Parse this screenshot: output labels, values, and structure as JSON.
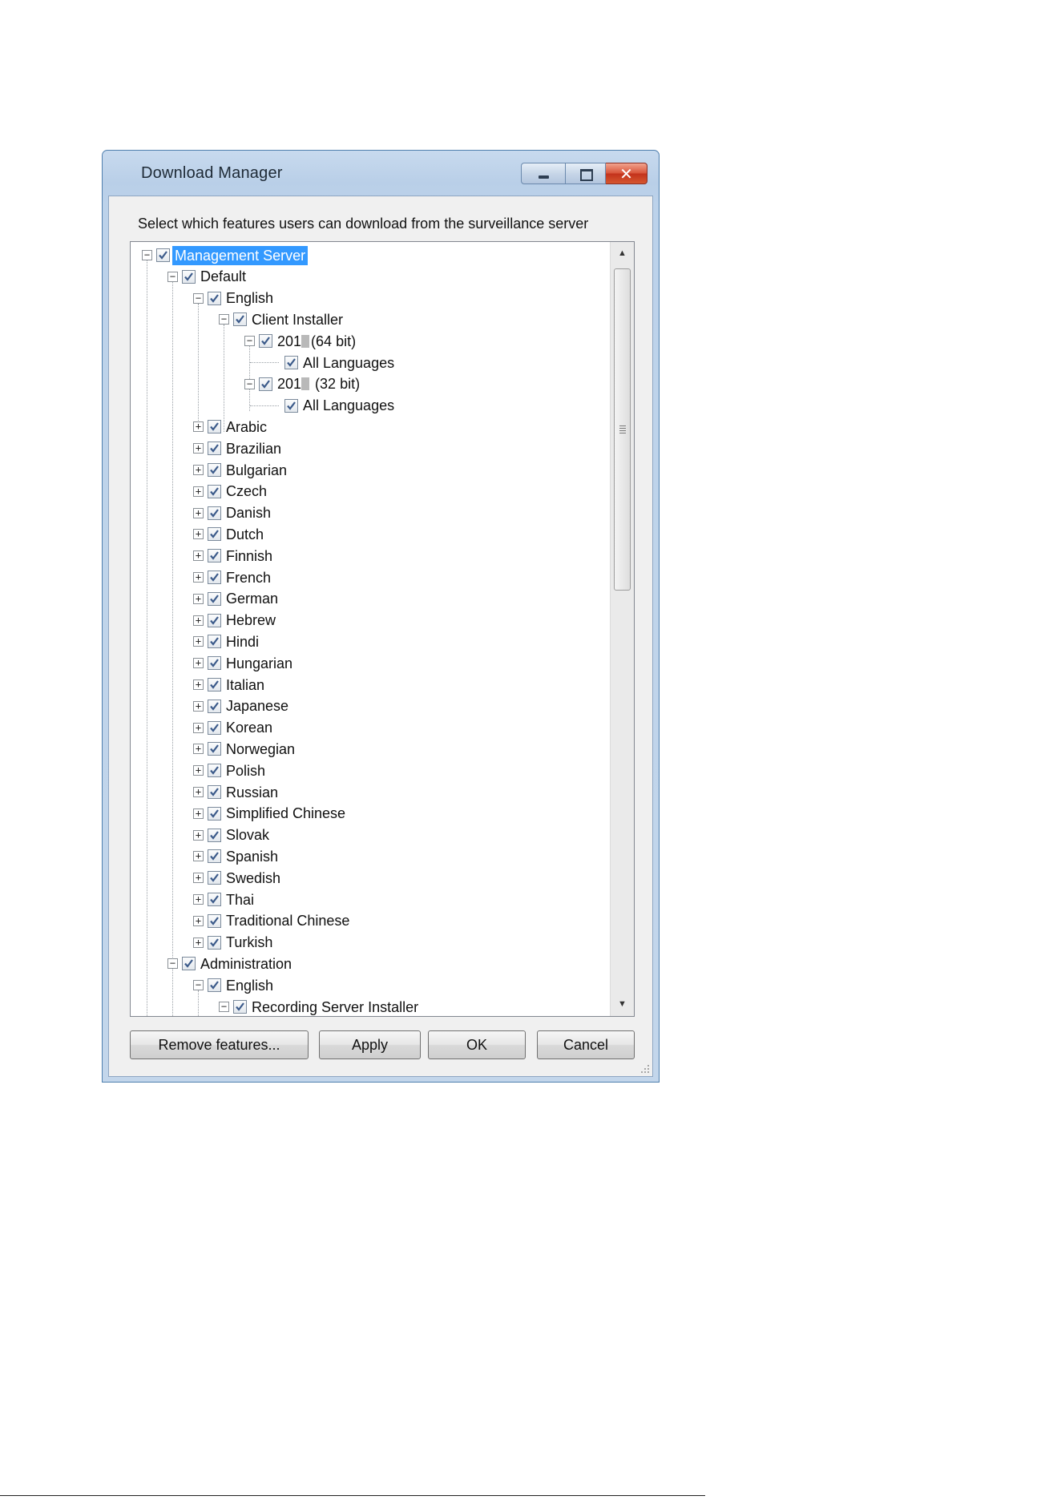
{
  "window": {
    "title": "Download Manager",
    "instruction": "Select which features users can download from the surveillance server"
  },
  "tree": {
    "nodes": [
      {
        "label": "Management Server",
        "level": 0,
        "expander": "minus",
        "checked": true,
        "selected": true
      },
      {
        "label": "Default",
        "level": 1,
        "expander": "minus",
        "checked": true
      },
      {
        "label": "English",
        "level": 2,
        "expander": "minus",
        "checked": true
      },
      {
        "label": "Client Installer",
        "level": 3,
        "expander": "minus",
        "checked": true
      },
      {
        "label": "201",
        "suffix": "(64 bit)",
        "redacted": true,
        "level": 4,
        "expander": "minus",
        "checked": true
      },
      {
        "label": "All Languages",
        "level": 5,
        "expander": "none",
        "checked": true
      },
      {
        "label": "201",
        "suffix": " (32 bit)",
        "redacted": true,
        "level": 4,
        "expander": "minus",
        "checked": true
      },
      {
        "label": "All Languages",
        "level": 5,
        "expander": "none",
        "checked": true
      },
      {
        "label": "Arabic",
        "level": 2,
        "expander": "plus",
        "checked": true
      },
      {
        "label": "Brazilian",
        "level": 2,
        "expander": "plus",
        "checked": true
      },
      {
        "label": "Bulgarian",
        "level": 2,
        "expander": "plus",
        "checked": true
      },
      {
        "label": "Czech",
        "level": 2,
        "expander": "plus",
        "checked": true
      },
      {
        "label": "Danish",
        "level": 2,
        "expander": "plus",
        "checked": true
      },
      {
        "label": "Dutch",
        "level": 2,
        "expander": "plus",
        "checked": true
      },
      {
        "label": "Finnish",
        "level": 2,
        "expander": "plus",
        "checked": true
      },
      {
        "label": "French",
        "level": 2,
        "expander": "plus",
        "checked": true
      },
      {
        "label": "German",
        "level": 2,
        "expander": "plus",
        "checked": true
      },
      {
        "label": "Hebrew",
        "level": 2,
        "expander": "plus",
        "checked": true
      },
      {
        "label": "Hindi",
        "level": 2,
        "expander": "plus",
        "checked": true
      },
      {
        "label": "Hungarian",
        "level": 2,
        "expander": "plus",
        "checked": true
      },
      {
        "label": "Italian",
        "level": 2,
        "expander": "plus",
        "checked": true
      },
      {
        "label": "Japanese",
        "level": 2,
        "expander": "plus",
        "checked": true
      },
      {
        "label": "Korean",
        "level": 2,
        "expander": "plus",
        "checked": true
      },
      {
        "label": "Norwegian",
        "level": 2,
        "expander": "plus",
        "checked": true
      },
      {
        "label": "Polish",
        "level": 2,
        "expander": "plus",
        "checked": true
      },
      {
        "label": "Russian",
        "level": 2,
        "expander": "plus",
        "checked": true
      },
      {
        "label": "Simplified Chinese",
        "level": 2,
        "expander": "plus",
        "checked": true
      },
      {
        "label": "Slovak",
        "level": 2,
        "expander": "plus",
        "checked": true
      },
      {
        "label": "Spanish",
        "level": 2,
        "expander": "plus",
        "checked": true
      },
      {
        "label": "Swedish",
        "level": 2,
        "expander": "plus",
        "checked": true
      },
      {
        "label": "Thai",
        "level": 2,
        "expander": "plus",
        "checked": true
      },
      {
        "label": "Traditional Chinese",
        "level": 2,
        "expander": "plus",
        "checked": true
      },
      {
        "label": "Turkish",
        "level": 2,
        "expander": "plus",
        "checked": true
      },
      {
        "label": "Administration",
        "level": 1,
        "expander": "minus",
        "checked": true
      },
      {
        "label": "English",
        "level": 2,
        "expander": "minus",
        "checked": true
      },
      {
        "label": "Recording Server Installer",
        "level": 3,
        "expander": "minus",
        "checked": true
      }
    ]
  },
  "buttons": {
    "remove": "Remove features...",
    "apply": "Apply",
    "ok": "OK",
    "cancel": "Cancel"
  },
  "icons": {
    "minimize": "minimize-icon",
    "maximize": "maximize-icon",
    "close": "close-icon",
    "check": "checkmark-icon",
    "scroll_up": "scroll-up-arrow-icon",
    "scroll_down": "scroll-down-arrow-icon"
  },
  "colors": {
    "selection": "#3399ff",
    "close_button": "#d9553b",
    "check_mark": "#3b5a8a"
  }
}
